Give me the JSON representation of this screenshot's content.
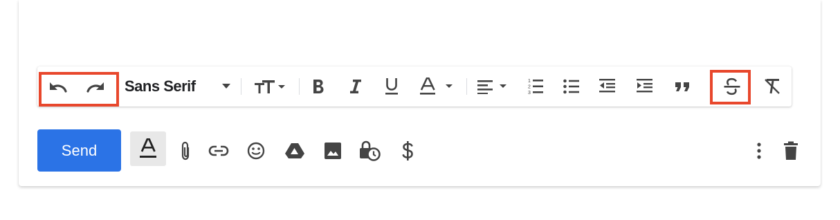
{
  "toolbar": {
    "font_name": "Sans Serif",
    "buttons": {
      "undo": "undo-icon",
      "redo": "redo-icon",
      "font_dropdown": "chevron-down-icon",
      "text_size": "text-size-icon",
      "bold": "bold-icon",
      "italic": "italic-icon",
      "underline": "underline-icon",
      "text_color": "text-color-icon",
      "align": "align-left-icon",
      "numbered_list": "numbered-list-icon",
      "bulleted_list": "bulleted-list-icon",
      "indent_less": "indent-less-icon",
      "indent_more": "indent-more-icon",
      "quote": "quote-icon",
      "strikethrough": "strikethrough-icon",
      "remove_formatting": "remove-formatting-icon"
    },
    "highlight_color": "#e8472c"
  },
  "bottom_bar": {
    "send_label": "Send",
    "send_color": "#2b73e6",
    "icons": [
      "formatting-options-icon",
      "attach-icon",
      "link-icon",
      "emoji-icon",
      "drive-icon",
      "photo-icon",
      "confidential-mode-icon",
      "dollar-icon",
      "more-options-icon",
      "trash-icon"
    ]
  }
}
